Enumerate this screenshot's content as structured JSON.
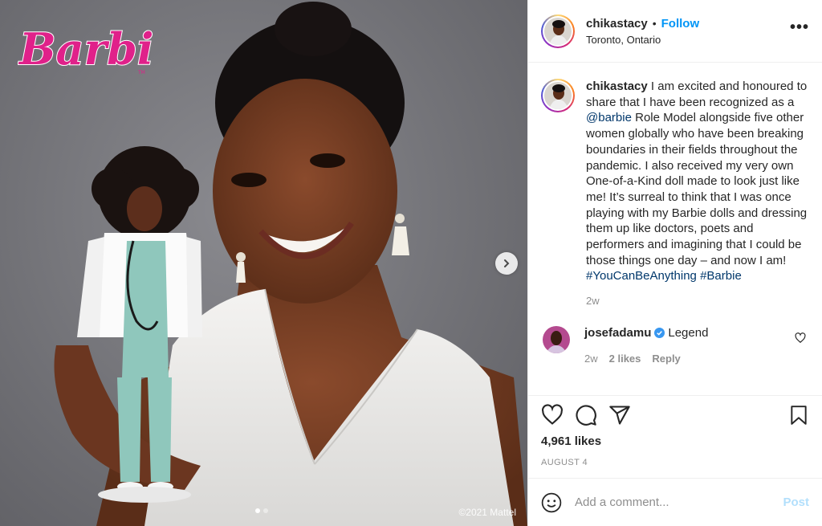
{
  "media": {
    "logo_text": "Barbie",
    "copyright": "©2021 Mattel",
    "carousel": {
      "total_slides": 2,
      "active_slide": 1
    }
  },
  "header": {
    "username": "chikastacy",
    "separator": "•",
    "follow_label": "Follow",
    "location": "Toronto, Ontario",
    "more_label": "•••"
  },
  "caption": {
    "username": "chikastacy",
    "text_part1": " I am excited and honoured to share that I have been recognized as a ",
    "mention": "@barbie",
    "text_part2": " Role Model alongside five other women globally who have been breaking boundaries in their fields throughout the pandemic. I also received my very own One-of-a-Kind doll made to look just like me! It’s surreal to think that I was once playing with my Barbie dolls and dressing them up like doctors, poets and performers and imagining that I could be those things one day – and now I am! ",
    "hashtag1": "#YouCanBeAnything",
    "space": " ",
    "hashtag2": "#Barbie",
    "time": "2w"
  },
  "comment": {
    "username": "josefadamu",
    "text": "Legend",
    "time": "2w",
    "likes": "2 likes",
    "reply_label": "Reply"
  },
  "actions": {
    "likes": "4,961 likes",
    "date": "AUGUST 4"
  },
  "add_comment": {
    "placeholder": "Add a comment...",
    "post_label": "Post"
  },
  "colors": {
    "accent": "#0095f6",
    "link": "#00376b",
    "muted": "#8e8e8e",
    "brand_pink": "#e0218a",
    "post_disabled": "#b2dffc"
  },
  "icons": [
    "heart-icon",
    "comment-icon",
    "share-icon",
    "bookmark-icon",
    "emoji-icon",
    "verified-icon",
    "chevron-right-icon",
    "more-icon"
  ]
}
